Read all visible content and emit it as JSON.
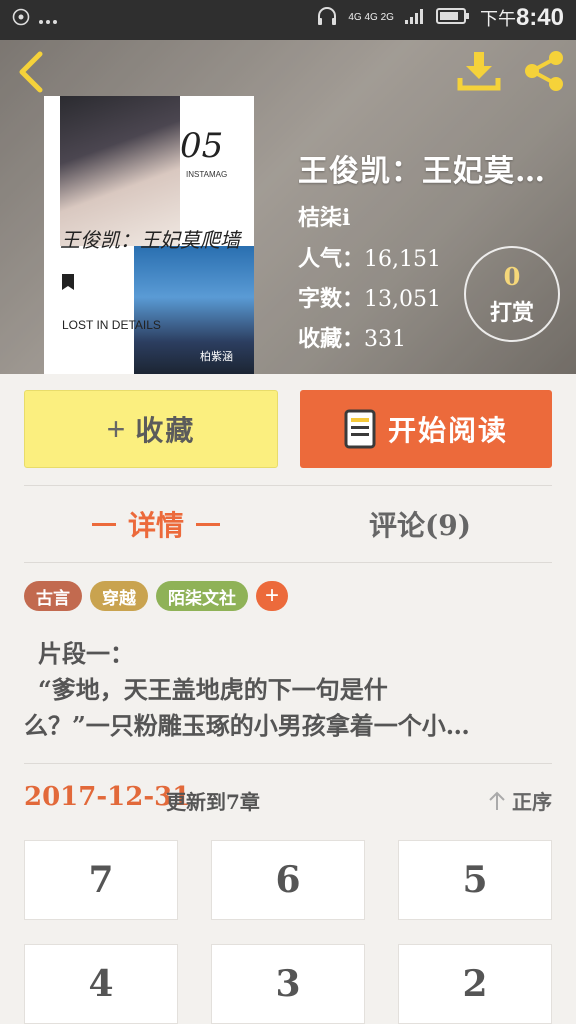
{
  "status_bar": {
    "left_icons": [
      "dolby-icon",
      "more-dots-icon"
    ],
    "network": "4G 4G 2G",
    "time_prefix": "下午",
    "time": "8:40"
  },
  "book": {
    "title": "王俊凯：王妃莫…",
    "author": "桔柒i",
    "stats": [
      {
        "label": "人气：",
        "value": "16,151"
      },
      {
        "label": "字数：",
        "value": "13,051"
      },
      {
        "label": "收藏：",
        "value": "331"
      }
    ],
    "cover": {
      "number": "05",
      "brand": "INSTAMAG",
      "title_text": "王俊凯：王妃莫爬墙",
      "badge_text": "LOST IN DETAILS",
      "signature": "柏紫涵"
    }
  },
  "tip": {
    "count": "0",
    "label": "打赏"
  },
  "actions": {
    "favorite_plus": "+",
    "favorite_label": "收藏",
    "read_label": "开始阅读"
  },
  "tabs": {
    "detail": "详情",
    "comments": "评论(9)"
  },
  "tags": [
    {
      "label": "古言",
      "color": "#c26a4f"
    },
    {
      "label": "穿越",
      "color": "#c9a34f"
    },
    {
      "label": "陌柒文社",
      "color": "#8fb257"
    }
  ],
  "tag_add": "+",
  "synopsis": {
    "lines": [
      "片段一：",
      "“爹地，天王盖地虎的下一句是什",
      "么？”一只粉雕玉琢的小男孩拿着一个小…"
    ]
  },
  "update": {
    "date": "2017-12-31",
    "text": "更新到7章",
    "sort_label": "正序"
  },
  "chapters": [
    "7",
    "6",
    "5",
    "4",
    "3",
    "2"
  ],
  "colors": {
    "accent": "#ec6a3b",
    "favorite": "#fbef7f",
    "tip_count": "#f5d77a"
  }
}
